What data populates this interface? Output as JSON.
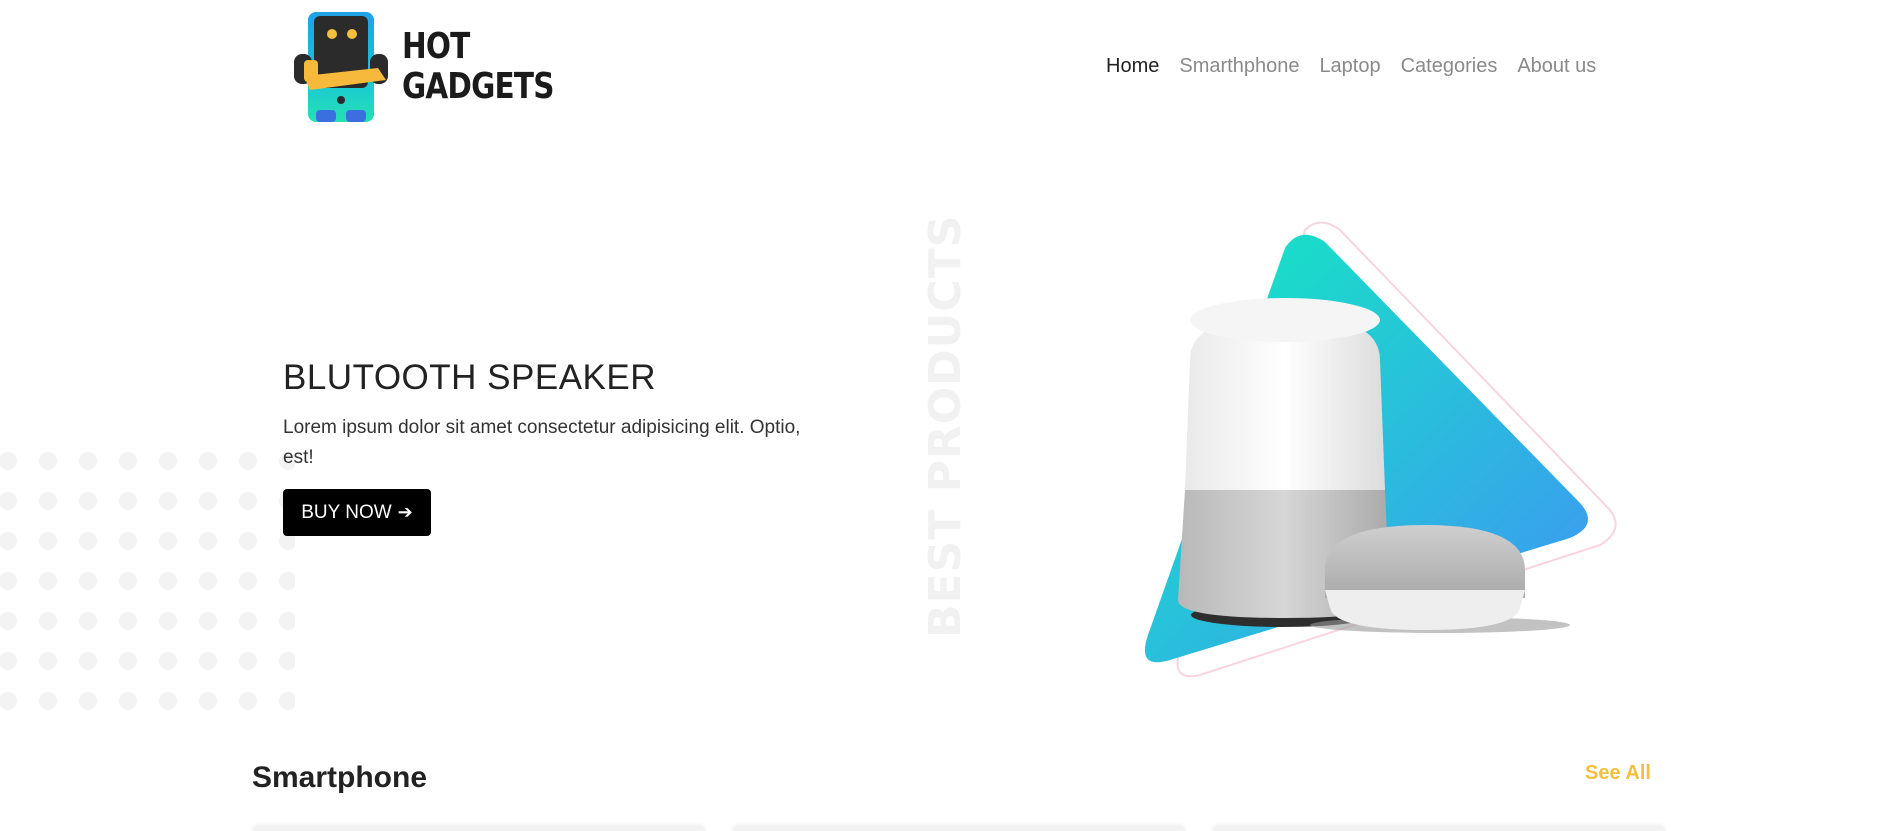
{
  "brand": {
    "line1": "HOT",
    "line2": "GADGETS"
  },
  "nav": {
    "items": [
      {
        "label": "Home",
        "active": true
      },
      {
        "label": "Smarthphone",
        "active": false
      },
      {
        "label": "Laptop",
        "active": false
      },
      {
        "label": "Categories",
        "active": false
      },
      {
        "label": "About us",
        "active": false
      }
    ]
  },
  "hero": {
    "title": "BLUTOOTH SPEAKER",
    "description": "Lorem ipsum dolor sit amet consectetur adipisicing elit. Optio, est!",
    "button_label": "BUY NOW",
    "button_icon": "arrow-right-icon",
    "vertical_text": "BEST PRODUCTS"
  },
  "section": {
    "title": "Smartphone",
    "see_all": "See All"
  },
  "colors": {
    "accent": "#f3bf3c",
    "triangle_start": "#12ebc0",
    "triangle_end": "#3f94f5",
    "button": "#000000"
  }
}
